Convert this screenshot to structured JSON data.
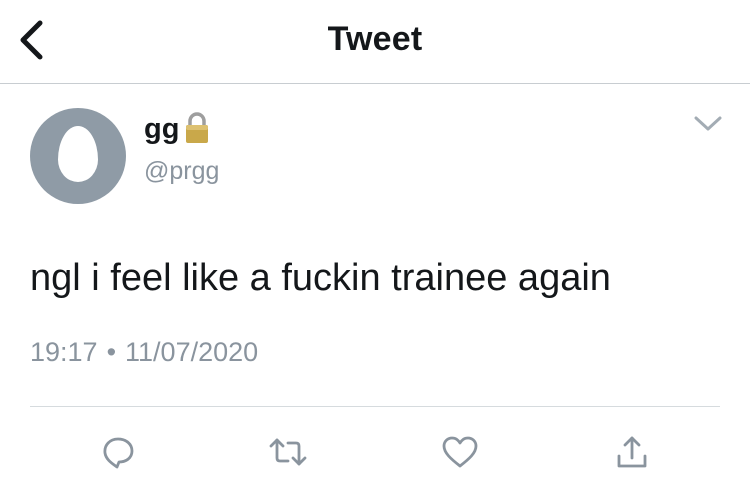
{
  "nav": {
    "title": "Tweet",
    "back_icon": "chevron-left-icon"
  },
  "tweet": {
    "author": {
      "display_name": "gg",
      "username": "@prgg",
      "protected_icon": "lock-icon",
      "avatar": "default-egg-avatar"
    },
    "text": "ngl i feel like a fuckin trainee again",
    "time": "19:17",
    "separator": "•",
    "date": "11/07/2020"
  },
  "actions": {
    "reply_icon": "reply-icon",
    "retweet_icon": "retweet-icon",
    "like_icon": "heart-icon",
    "share_icon": "share-icon"
  },
  "colors": {
    "text": "#14171a",
    "secondary_text": "#8a949e",
    "icon_gray": "#8a949e",
    "avatar_bg": "#8f9ba6",
    "divider": "#c8cdd1"
  }
}
